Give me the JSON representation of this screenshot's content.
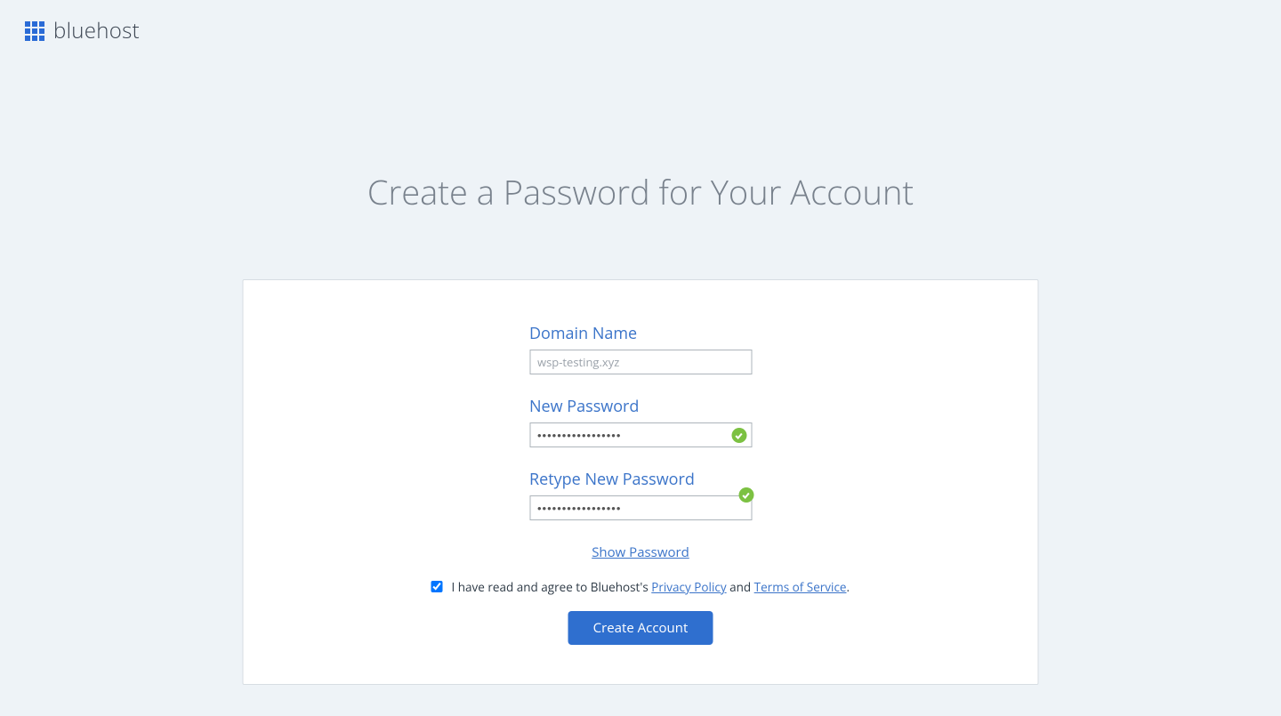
{
  "brand": "bluehost",
  "heading": "Create a Password for Your Account",
  "fields": {
    "domain": {
      "label": "Domain Name",
      "value": "wsp-testing.xyz"
    },
    "new_password": {
      "label": "New Password",
      "value": "•••••••••••••••••"
    },
    "retype_password": {
      "label": "Retype New Password",
      "value": "•••••••••••••••••"
    }
  },
  "show_password_label": "Show Password",
  "agree": {
    "prefix": "I have read and agree to Bluehost's ",
    "privacy": "Privacy Policy",
    "joiner": " and ",
    "terms": "Terms of Service",
    "suffix": "."
  },
  "submit_label": "Create Account"
}
